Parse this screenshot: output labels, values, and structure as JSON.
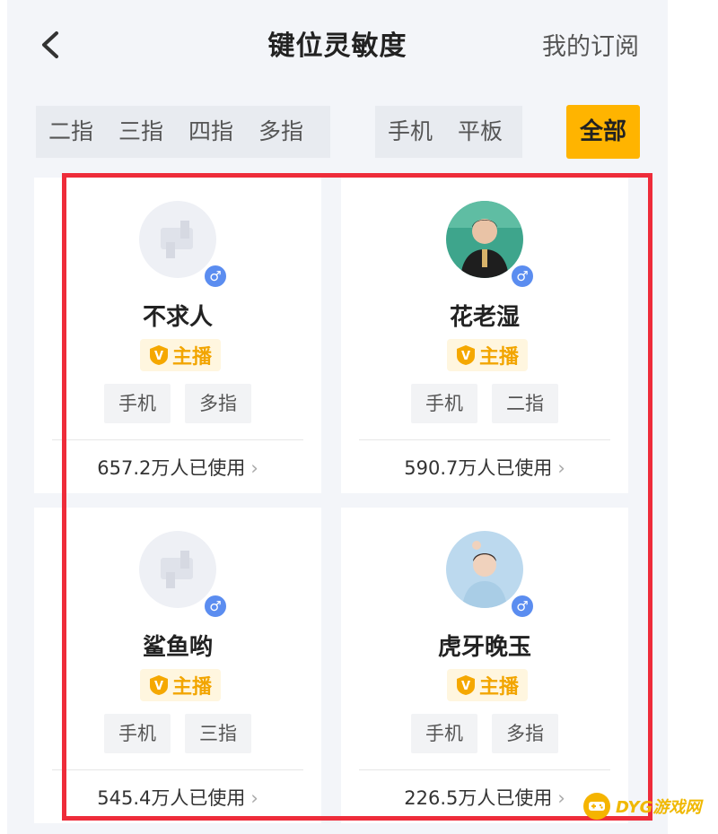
{
  "header": {
    "title": "键位灵敏度",
    "subscribe_label": "我的订阅",
    "back_icon": "chevron-left-icon"
  },
  "filters": {
    "fingers": [
      "二指",
      "三指",
      "四指",
      "多指"
    ],
    "devices": [
      "手机",
      "平板"
    ],
    "all_label": "全部",
    "accent_color": "#ffb400"
  },
  "cards": [
    {
      "name": "不求人",
      "badge": "主播",
      "tags": [
        "手机",
        "多指"
      ],
      "usage": "657.2万人已使用",
      "avatar": "placeholder-avatar",
      "gender_icon": "male-icon"
    },
    {
      "name": "花老湿",
      "badge": "主播",
      "tags": [
        "手机",
        "二指"
      ],
      "usage": "590.7万人已使用",
      "avatar": "photo-avatar",
      "gender_icon": "male-icon"
    },
    {
      "name": "鲨鱼哟",
      "badge": "主播",
      "tags": [
        "手机",
        "三指"
      ],
      "usage": "545.4万人已使用",
      "avatar": "placeholder-avatar",
      "gender_icon": "male-icon"
    },
    {
      "name": "虎牙晚玉",
      "badge": "主播",
      "tags": [
        "手机",
        "多指"
      ],
      "usage": "226.5万人已使用",
      "avatar": "photo-avatar",
      "gender_icon": "male-icon"
    }
  ],
  "gender_symbol": "♂",
  "chevron_symbol": "›",
  "watermark": {
    "text": "DYG游戏网"
  },
  "colors": {
    "highlight_border": "#ee2c3a",
    "badge_text": "#f2a500",
    "gender_badge": "#5b8df0"
  }
}
